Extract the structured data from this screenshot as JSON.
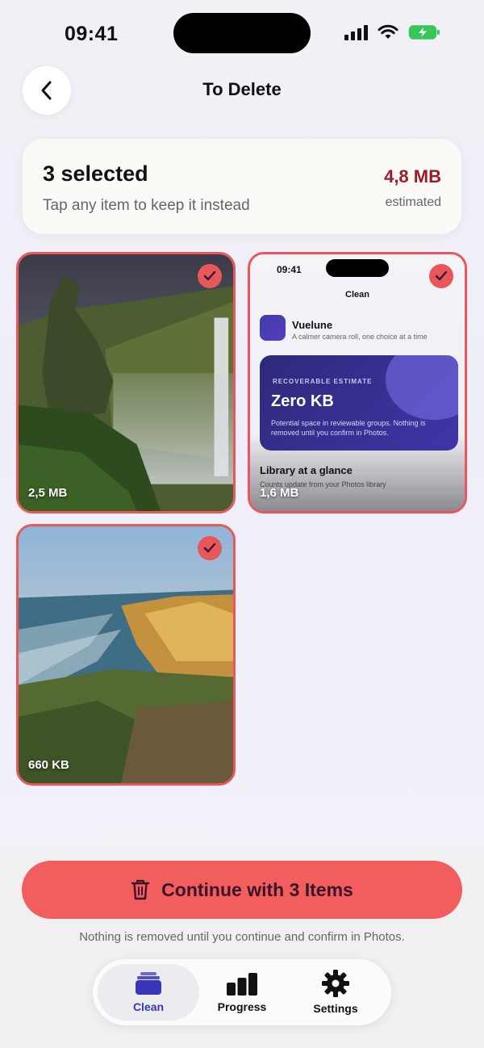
{
  "status_bar": {
    "time": "09:41"
  },
  "header": {
    "title": "To Delete"
  },
  "summary": {
    "count_label": "3 selected",
    "hint": "Tap any item to keep it instead",
    "size": "4,8 MB",
    "size_note": "estimated"
  },
  "photos": [
    {
      "size": "2,5 MB",
      "selected": true
    },
    {
      "size": "1,6 MB",
      "selected": true
    },
    {
      "size": "660 KB",
      "selected": true
    }
  ],
  "screenshot_preview": {
    "time": "09:41",
    "title": "Clean",
    "app_name": "Vuelune",
    "tagline": "A calmer camera roll, one choice at a time",
    "eyebrow": "RECOVERABLE ESTIMATE",
    "value": "Zero KB",
    "description": "Potential space in reviewable groups. Nothing is removed until you confirm in Photos.",
    "section_title": "Library at a glance",
    "section_sub": "Counts update from your Photos library"
  },
  "actions": {
    "continue_label": "Continue with 3 Items",
    "footnote": "Nothing is removed until you continue and confirm in Photos."
  },
  "tabs": [
    {
      "label": "Clean",
      "icon": "stack-icon",
      "active": true
    },
    {
      "label": "Progress",
      "icon": "bar-chart-icon",
      "active": false
    },
    {
      "label": "Settings",
      "icon": "gear-icon",
      "active": false
    }
  ],
  "colors": {
    "accent": "#f25d5e",
    "brand": "#3a35b8",
    "size_red": "#9b1c26"
  }
}
